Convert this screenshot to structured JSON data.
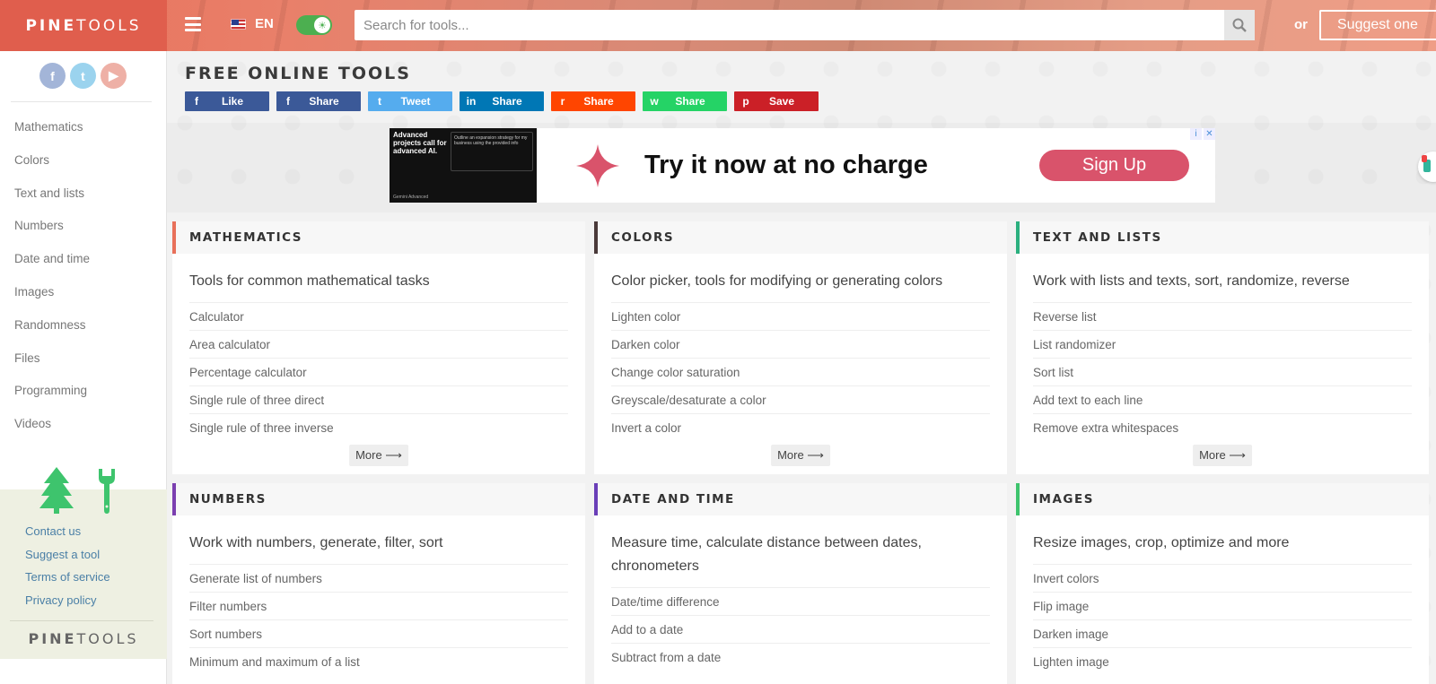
{
  "header": {
    "logo_bold": "PINE",
    "logo_light": "TOOLS",
    "language": "EN",
    "search_placeholder": "Search for tools...",
    "or_text": "or",
    "suggest_label": "Suggest one"
  },
  "sidebar": {
    "socials": [
      "f",
      "t",
      "▶"
    ],
    "items": [
      "Mathematics",
      "Colors",
      "Text and lists",
      "Numbers",
      "Date and time",
      "Images",
      "Randomness",
      "Files",
      "Programming",
      "Videos"
    ],
    "links": [
      "Contact us",
      "Suggest a tool",
      "Terms of service",
      "Privacy policy"
    ],
    "logo_bold": "PINE",
    "logo_light": "TOOLS"
  },
  "main": {
    "title": "FREE ONLINE TOOLS",
    "share_buttons": [
      {
        "icon": "f",
        "label": "Like",
        "color": "#3b5998"
      },
      {
        "icon": "f",
        "label": "Share",
        "color": "#3b5998"
      },
      {
        "icon": "t",
        "label": "Tweet",
        "color": "#55acee"
      },
      {
        "icon": "in",
        "label": "Share",
        "color": "#0077b5"
      },
      {
        "icon": "r",
        "label": "Share",
        "color": "#ff4500"
      },
      {
        "icon": "w",
        "label": "Share",
        "color": "#25d366"
      },
      {
        "icon": "p",
        "label": "Save",
        "color": "#cb2027"
      }
    ]
  },
  "ad": {
    "thumb_title": "Advanced projects call for advanced AI.",
    "thumb_panel": "Outline an expansion strategy for my business using the provided info",
    "thumb_brand": "Gemini Advanced",
    "headline": "Try it now at no charge",
    "cta": "Sign Up",
    "info": "i",
    "close": "✕"
  },
  "cards": [
    {
      "title": "MATHEMATICS",
      "accent": "#e8705a",
      "desc": "Tools for common mathematical tasks",
      "items": [
        "Calculator",
        "Area calculator",
        "Percentage calculator",
        "Single rule of three direct",
        "Single rule of three inverse"
      ],
      "more": "More ⟶"
    },
    {
      "title": "COLORS",
      "accent": "#4a3a3a",
      "desc": "Color picker, tools for modifying or generating colors",
      "items": [
        "Lighten color",
        "Darken color",
        "Change color saturation",
        "Greyscale/desaturate a color",
        "Invert a color"
      ],
      "more": "More ⟶"
    },
    {
      "title": "TEXT AND LISTS",
      "accent": "#2bb07f",
      "desc": "Work with lists and texts, sort, randomize, reverse",
      "items": [
        "Reverse list",
        "List randomizer",
        "Sort list",
        "Add text to each line",
        "Remove extra whitespaces"
      ],
      "more": "More ⟶"
    },
    {
      "title": "NUMBERS",
      "accent": "#7b3fb0",
      "desc": "Work with numbers, generate, filter, sort",
      "items": [
        "Generate list of numbers",
        "Filter numbers",
        "Sort numbers",
        "Minimum and maximum of a list"
      ]
    },
    {
      "title": "DATE AND TIME",
      "accent": "#6a3fb8",
      "desc": "Measure time, calculate distance between dates, chronometers",
      "items": [
        "Date/time difference",
        "Add to a date",
        "Subtract from a date"
      ]
    },
    {
      "title": "IMAGES",
      "accent": "#3ec46d",
      "desc": "Resize images, crop, optimize and more",
      "items": [
        "Invert colors",
        "Flip image",
        "Darken image",
        "Lighten image"
      ]
    }
  ]
}
